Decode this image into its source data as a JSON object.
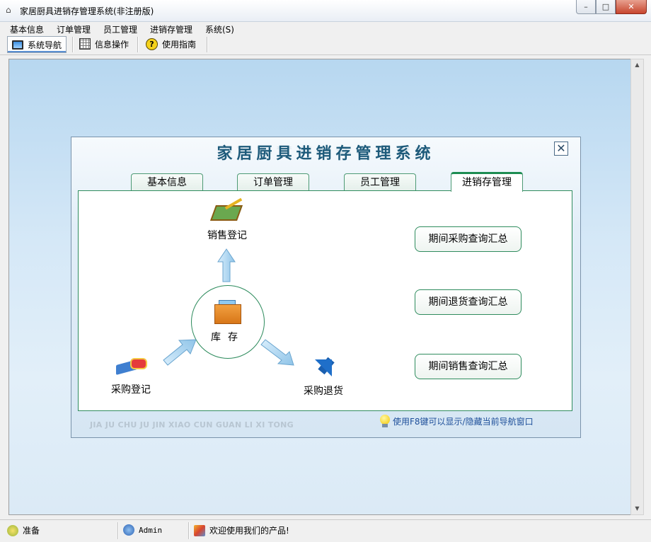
{
  "window": {
    "title": "家居厨具进销存管理系统(非注册版)",
    "controls": {
      "minimize": "–",
      "maximize": "□",
      "close": "✕"
    }
  },
  "menu": [
    "基本信息",
    "订单管理",
    "员工管理",
    "进销存管理",
    "系统(S)"
  ],
  "toolbar": {
    "buttons": [
      {
        "label": "系统导航",
        "icon": "monitor-icon",
        "active": true
      },
      {
        "label": "信息操作",
        "icon": "grid-icon",
        "active": false
      },
      {
        "label": "使用指南",
        "icon": "help-icon",
        "active": false
      }
    ]
  },
  "nav_panel": {
    "title": "家居厨具进销存管理系统",
    "close": "✕",
    "tabs": [
      "基本信息",
      "订单管理",
      "员工管理",
      "进销存管理"
    ],
    "active_tab": "进销存管理",
    "nodes": {
      "sales_register": "销售登记",
      "inventory": "库存",
      "purchase_register": "采购登记",
      "purchase_return": "采购退货"
    },
    "buttons": [
      "期间采购查询汇总",
      "期间退货查询汇总",
      "期间销售查询汇总"
    ],
    "footer_pinyin": "JIA JU CHU JU JIN XIAO CUN GUAN LI XI TONG",
    "footer_tip": "使用F8键可以显示/隐藏当前导航窗口"
  },
  "statusbar": {
    "status": "准备",
    "user": "Admin",
    "message": "欢迎使用我们的产品!"
  },
  "colors": {
    "accent_green": "#2f8c5e",
    "title_blue": "#1d5a7a",
    "tip_blue": "#1e4f9a"
  }
}
